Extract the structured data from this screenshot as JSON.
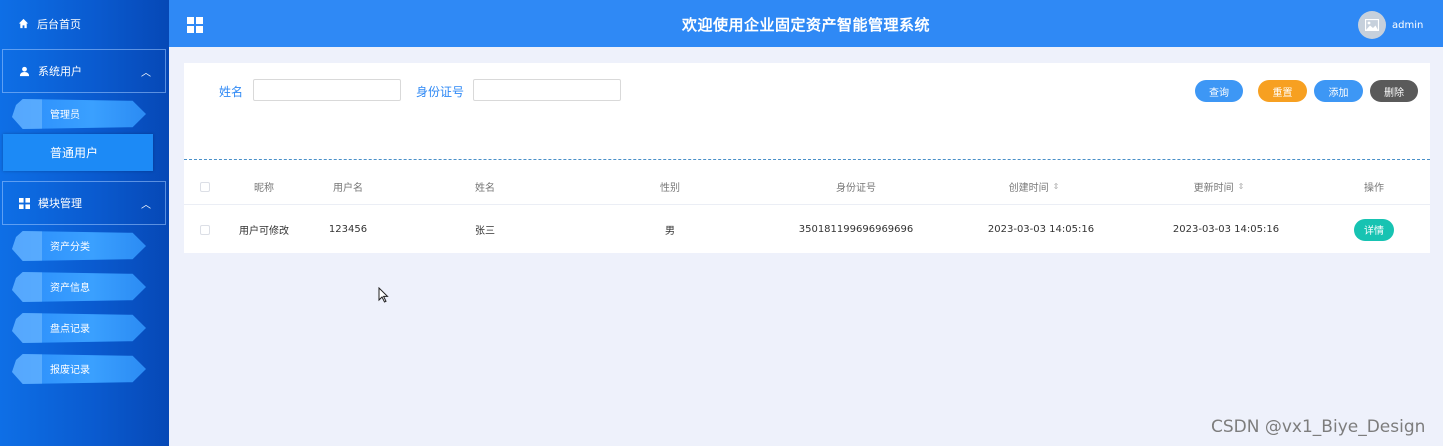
{
  "header": {
    "title": "欢迎使用企业固定资产智能管理系统",
    "username": "admin"
  },
  "sidebar": {
    "home": "后台首页",
    "groups": [
      {
        "label": "系统用户",
        "items": [
          "管理员",
          "普通用户"
        ]
      },
      {
        "label": "模块管理",
        "items": [
          "资产分类",
          "资产信息",
          "盘点记录",
          "报废记录"
        ]
      }
    ]
  },
  "search": {
    "name_label": "姓名",
    "name_value": "",
    "id_label": "身份证号",
    "id_value": ""
  },
  "buttons": {
    "query": "查询",
    "reset": "重置",
    "add": "添加",
    "delete": "删除"
  },
  "colors": {
    "query": "#3d97f5",
    "reset": "#f7a021",
    "add": "#3d97f5",
    "delete": "#5a5a5a",
    "detail": "#17c3b2"
  },
  "table": {
    "headers": [
      "昵称",
      "用户名",
      "姓名",
      "性别",
      "身份证号",
      "创建时间",
      "更新时间",
      "操作"
    ],
    "rows": [
      {
        "nickname": "用户可修改",
        "username": "123456",
        "name": "张三",
        "gender": "男",
        "id_number": "350181199696969696",
        "created": "2023-03-03 14:05:16",
        "updated": "2023-03-03 14:05:16",
        "action": "详情"
      }
    ]
  },
  "watermark": "CSDN @vx1_Biye_Design"
}
